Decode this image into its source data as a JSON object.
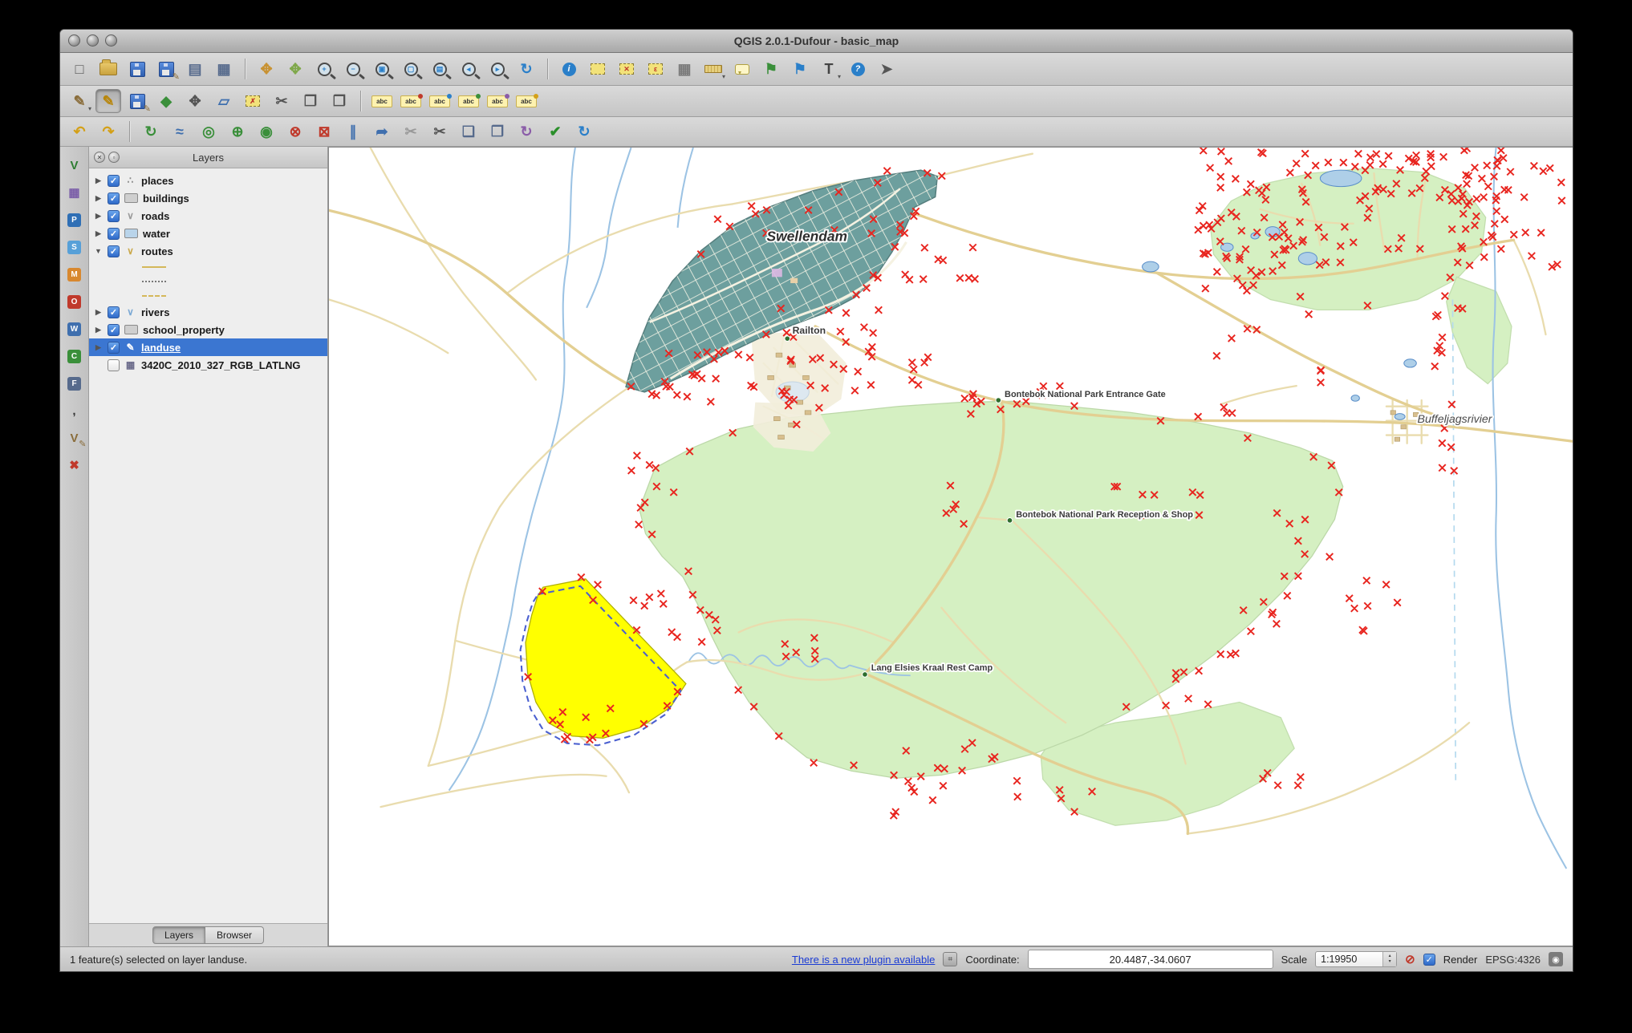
{
  "window": {
    "title": "QGIS 2.0.1-Dufour - basic_map"
  },
  "panels": {
    "layers": {
      "title": "Layers",
      "tabs": [
        {
          "label": "Layers",
          "active": true
        },
        {
          "label": "Browser",
          "active": false
        }
      ]
    }
  },
  "layer_tree": {
    "items": [
      {
        "label": "places",
        "checked": true,
        "type": "marker"
      },
      {
        "label": "buildings",
        "checked": true,
        "type": "polygon",
        "color": "#cfcfcf"
      },
      {
        "label": "roads",
        "checked": true,
        "type": "line",
        "color": "#9a9a9a"
      },
      {
        "label": "water",
        "checked": true,
        "type": "polygon",
        "color": "#b9d4ea"
      },
      {
        "label": "routes",
        "checked": true,
        "type": "line",
        "color": "#caa84a",
        "expanded": true,
        "children": [
          {
            "style": "solid"
          },
          {
            "style": "dots"
          },
          {
            "style": "dash"
          }
        ]
      },
      {
        "label": "rivers",
        "checked": true,
        "type": "line",
        "color": "#7aa8d4"
      },
      {
        "label": "school_property",
        "checked": true,
        "type": "polygon",
        "color": "#cfcfcf"
      },
      {
        "label": "landuse",
        "checked": true,
        "type": "polygon",
        "color": "#cfcfcf",
        "selected": true,
        "editing": true
      },
      {
        "label": "3420C_2010_327_RGB_LATLNG",
        "checked": false,
        "type": "raster"
      }
    ]
  },
  "map": {
    "labels": {
      "swellendam": "Swellendam",
      "railton": "Railton",
      "entrance_gate": "Bontebok National Park Entrance Gate",
      "reception": "Bontebok National Park Reception & Shop",
      "rest_camp": "Lang Elsies Kraal Rest Camp",
      "buffeljagsrivier": "Buffeljagsrivier"
    }
  },
  "status_bar": {
    "message": "1 feature(s) selected on layer landuse.",
    "plugin_link": "There is a new plugin available",
    "coordinate_label": "Coordinate:",
    "coordinate_value": "20.4487,-34.0607",
    "scale_label": "Scale",
    "scale_value": "1:19950",
    "render_label": "Render",
    "epsg_label": "EPSG:4326"
  },
  "toolbars": {
    "file": [
      {
        "name": "new-project",
        "kind": "glyph",
        "glyph": "□",
        "color": "#555555"
      },
      {
        "name": "open-project",
        "kind": "folder"
      },
      {
        "name": "save-project",
        "kind": "floppy"
      },
      {
        "name": "save-project-as",
        "kind": "floppy",
        "overlay": "✎"
      },
      {
        "name": "new-print-composer",
        "kind": "glyph",
        "glyph": "▤",
        "color": "#566a8c"
      },
      {
        "name": "composer-manager",
        "kind": "glyph",
        "glyph": "▦",
        "color": "#566a8c"
      },
      {
        "kind": "sep"
      },
      {
        "name": "pan-map",
        "kind": "glyph",
        "glyph": "✥",
        "color": "#c89232"
      },
      {
        "name": "pan-to-selection",
        "kind": "glyph",
        "glyph": "✥",
        "color": "#7fa84a"
      },
      {
        "name": "zoom-in",
        "kind": "mag",
        "glyph": "+"
      },
      {
        "name": "zoom-out",
        "kind": "mag",
        "glyph": "−"
      },
      {
        "name": "zoom-full-extent",
        "kind": "mag",
        "glyph": "▣"
      },
      {
        "name": "zoom-to-selection",
        "kind": "mag",
        "glyph": "▢"
      },
      {
        "name": "zoom-to-layer",
        "kind": "mag",
        "glyph": "▤"
      },
      {
        "name": "zoom-last",
        "kind": "mag",
        "glyph": "◂"
      },
      {
        "name": "zoom-next",
        "kind": "mag",
        "glyph": "▸"
      },
      {
        "name": "refresh-map",
        "kind": "glyph",
        "glyph": "↻",
        "color": "#2a7fc9"
      },
      {
        "kind": "sep"
      },
      {
        "name": "identify-features",
        "kind": "qmark",
        "glyph": "i",
        "color": "#2a7fc9"
      },
      {
        "name": "select-features",
        "kind": "selrect",
        "glyph": ""
      },
      {
        "name": "deselect-features",
        "kind": "selrect",
        "glyph": "✕"
      },
      {
        "name": "select-by-expression",
        "kind": "selrect",
        "glyph": "ε"
      },
      {
        "name": "open-attribute-table",
        "kind": "glyph",
        "glyph": "▦",
        "color": "#7a7a7a"
      },
      {
        "name": "measure-line",
        "kind": "ruler",
        "arrow": true
      },
      {
        "name": "map-tips",
        "kind": "balloon"
      },
      {
        "name": "new-bookmark",
        "kind": "glyph",
        "glyph": "⚑",
        "color": "#3a8f3a"
      },
      {
        "name": "show-bookmarks",
        "kind": "glyph",
        "glyph": "⚑",
        "color": "#2a7fc9"
      },
      {
        "name": "text-annotation",
        "kind": "glyph",
        "glyph": "T",
        "color": "#444444",
        "arrow": true
      },
      {
        "name": "help-contents",
        "kind": "qmark",
        "glyph": "?",
        "color": "#2a7fc9"
      },
      {
        "name": "whats-this",
        "kind": "glyph",
        "glyph": "➤",
        "color": "#555555"
      }
    ],
    "digitizing": [
      {
        "name": "current-edits",
        "kind": "glyph",
        "glyph": "✎",
        "color": "#8a6d3b",
        "arrow": true
      },
      {
        "name": "toggle-editing",
        "kind": "glyph",
        "glyph": "✎",
        "color": "#b8860b",
        "active": true
      },
      {
        "name": "save-layer-edits",
        "kind": "floppy",
        "overlay": "✎"
      },
      {
        "name": "add-feature",
        "kind": "glyph",
        "glyph": "◆",
        "color": "#3a8f3a"
      },
      {
        "name": "move-feature",
        "kind": "glyph",
        "glyph": "✥",
        "color": "#555555"
      },
      {
        "name": "node-tool",
        "kind": "glyph",
        "glyph": "▱",
        "color": "#3f6fae"
      },
      {
        "name": "delete-selected",
        "kind": "selrect",
        "glyph": "✗"
      },
      {
        "name": "cut-features",
        "kind": "glyph",
        "glyph": "✂",
        "color": "#555555"
      },
      {
        "name": "copy-features",
        "kind": "glyph",
        "glyph": "❐",
        "color": "#555555"
      },
      {
        "name": "paste-features",
        "kind": "glyph",
        "glyph": "❒",
        "color": "#555555"
      },
      {
        "kind": "sep"
      },
      {
        "name": "labeling",
        "kind": "abc"
      },
      {
        "name": "label-pin",
        "kind": "abc",
        "dot": "#c0392b"
      },
      {
        "name": "label-show-hide",
        "kind": "abc",
        "dot": "#2a7fc9"
      },
      {
        "name": "label-move",
        "kind": "abc",
        "dot": "#3a8f3a"
      },
      {
        "name": "label-rotate",
        "kind": "abc",
        "dot": "#8a5ca8"
      },
      {
        "name": "label-properties",
        "kind": "abc",
        "dot": "#d4a017"
      }
    ],
    "advanced": [
      {
        "name": "undo",
        "kind": "glyph",
        "glyph": "↶",
        "color": "#d4a017"
      },
      {
        "name": "redo",
        "kind": "glyph",
        "glyph": "↷",
        "color": "#d4a017"
      },
      {
        "kind": "sep"
      },
      {
        "name": "rotate-feature",
        "kind": "glyph",
        "glyph": "↻",
        "color": "#3a8f3a"
      },
      {
        "name": "simplify-feature",
        "kind": "glyph",
        "glyph": "≈",
        "color": "#3f6fae"
      },
      {
        "name": "add-ring",
        "kind": "glyph",
        "glyph": "◎",
        "color": "#3a8f3a"
      },
      {
        "name": "add-part",
        "kind": "glyph",
        "glyph": "⊕",
        "color": "#3a8f3a"
      },
      {
        "name": "fill-ring",
        "kind": "glyph",
        "glyph": "◉",
        "color": "#3a8f3a"
      },
      {
        "name": "delete-ring",
        "kind": "glyph",
        "glyph": "⊗",
        "color": "#c0392b"
      },
      {
        "name": "delete-part",
        "kind": "glyph",
        "glyph": "⊠",
        "color": "#c0392b"
      },
      {
        "name": "offset-curve",
        "kind": "glyph",
        "glyph": "∥",
        "color": "#3f6fae"
      },
      {
        "name": "reshape-features",
        "kind": "glyph",
        "glyph": "➦",
        "color": "#3f6fae"
      },
      {
        "name": "split-parts",
        "kind": "glyph",
        "glyph": "✂",
        "color": "#999999"
      },
      {
        "name": "split-features",
        "kind": "glyph",
        "glyph": "✂",
        "color": "#555555"
      },
      {
        "name": "merge-features",
        "kind": "glyph",
        "glyph": "❑",
        "color": "#566a8c"
      },
      {
        "name": "merge-attributes",
        "kind": "glyph",
        "glyph": "❒",
        "color": "#566a8c"
      },
      {
        "name": "rotate-point-symbols",
        "kind": "glyph",
        "glyph": "↻",
        "color": "#8a5ca8"
      },
      {
        "name": "check-geometries",
        "kind": "glyph",
        "glyph": "✔",
        "color": "#2a8f2a"
      },
      {
        "name": "redraw",
        "kind": "glyph",
        "glyph": "↻",
        "color": "#2a7fc9"
      }
    ],
    "layers_sidebar": [
      {
        "name": "add-vector-layer",
        "kind": "glyph",
        "glyph": "V",
        "color": "#2e7d32"
      },
      {
        "name": "add-raster-layer",
        "kind": "glyph",
        "glyph": "▦",
        "color": "#7a5ca8"
      },
      {
        "name": "add-postgis-layer",
        "kind": "letter",
        "glyph": "P",
        "color": "#2f6fb5"
      },
      {
        "name": "add-spatialite-layer",
        "kind": "letter",
        "glyph": "S",
        "color": "#57a0d8"
      },
      {
        "name": "add-mssql-layer",
        "kind": "letter",
        "glyph": "M",
        "color": "#d8882f"
      },
      {
        "name": "add-oracle-layer",
        "kind": "letter",
        "glyph": "O",
        "color": "#c0392b"
      },
      {
        "name": "add-wms-layer",
        "kind": "letter",
        "glyph": "W",
        "color": "#3f6fae"
      },
      {
        "name": "add-wcs-layer",
        "kind": "letter",
        "glyph": "C",
        "color": "#3a8f3a"
      },
      {
        "name": "add-wfs-layer",
        "kind": "letter",
        "glyph": "F",
        "color": "#566a8c"
      },
      {
        "name": "add-delimited-text-layer",
        "kind": "glyph",
        "glyph": ",",
        "color": "#333333"
      },
      {
        "name": "new-shapefile-layer",
        "kind": "glyph",
        "glyph": "V",
        "color": "#8a6d3b",
        "overlay": "✎"
      },
      {
        "name": "remove-layer",
        "kind": "glyph",
        "glyph": "✖",
        "color": "#c0392b"
      }
    ]
  }
}
